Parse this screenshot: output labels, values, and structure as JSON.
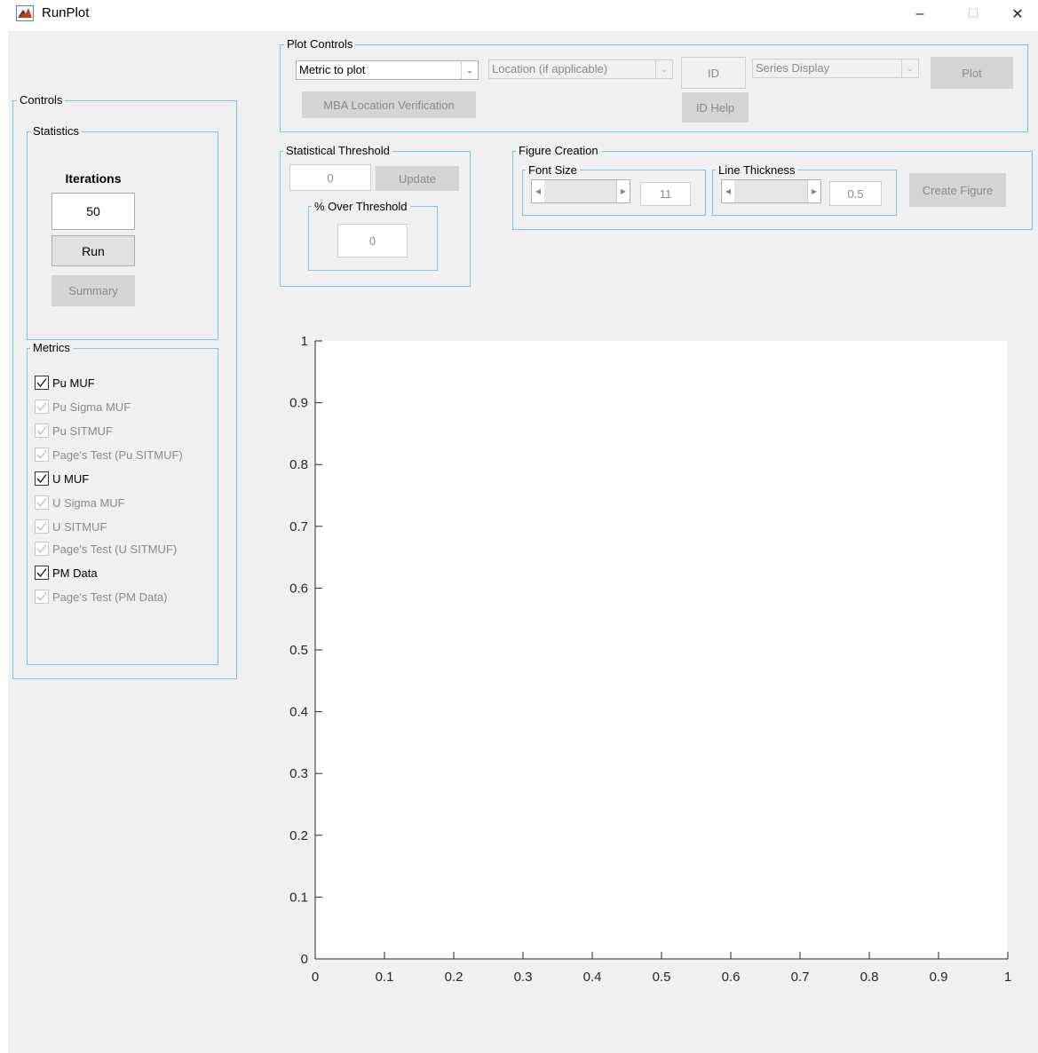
{
  "window": {
    "title": "RunPlot",
    "buttons": [
      "–",
      "□",
      "✕"
    ]
  },
  "plot_controls": {
    "title": "Plot Controls",
    "metric_dropdown": "Metric to plot",
    "location_dropdown": "Location (if applicable)",
    "id_button": "ID",
    "series_dropdown": "Series Display",
    "plot_button": "Plot",
    "mba_button": "MBA Location Verification",
    "id_help_button": "ID Help"
  },
  "controls": {
    "title": "Controls",
    "statistics": {
      "title": "Statistics",
      "iterations_label": "Iterations",
      "iterations_value": "50",
      "run_button": "Run",
      "summary_button": "Summary"
    },
    "metrics": {
      "title": "Metrics",
      "items": [
        {
          "label": "Pu MUF",
          "checked": true,
          "enabled": true
        },
        {
          "label": "Pu Sigma MUF",
          "checked": true,
          "enabled": false
        },
        {
          "label": "Pu SITMUF",
          "checked": true,
          "enabled": false
        },
        {
          "label": "Page's Test (Pu SITMUF)",
          "checked": true,
          "enabled": false
        },
        {
          "label": "U MUF",
          "checked": true,
          "enabled": true
        },
        {
          "label": "U Sigma MUF",
          "checked": true,
          "enabled": false
        },
        {
          "label": "U SITMUF",
          "checked": true,
          "enabled": false
        },
        {
          "label": "Page's Test (U SITMUF)",
          "checked": true,
          "enabled": false
        },
        {
          "label": "PM Data",
          "checked": true,
          "enabled": true
        },
        {
          "label": "Page's Test (PM Data)",
          "checked": true,
          "enabled": false
        }
      ]
    }
  },
  "statistical_threshold": {
    "title": "Statistical Threshold",
    "value": "0",
    "update_button": "Update",
    "over_title": "% Over Threshold",
    "over_value": "0"
  },
  "figure_creation": {
    "title": "Figure Creation",
    "font_size_title": "Font Size",
    "font_size_value": "11",
    "line_thickness_title": "Line Thickness",
    "line_thickness_value": "0.5",
    "create_button": "Create Figure"
  },
  "chart_data": {
    "type": "line",
    "series": [],
    "xlim": [
      0,
      1
    ],
    "ylim": [
      0,
      1
    ],
    "xticks": [
      "0",
      "0.1",
      "0.2",
      "0.3",
      "0.4",
      "0.5",
      "0.6",
      "0.7",
      "0.8",
      "0.9",
      "1"
    ],
    "yticks": [
      "0",
      "0.1",
      "0.2",
      "0.3",
      "0.4",
      "0.5",
      "0.6",
      "0.7",
      "0.8",
      "0.9",
      "1"
    ],
    "grid": false
  }
}
